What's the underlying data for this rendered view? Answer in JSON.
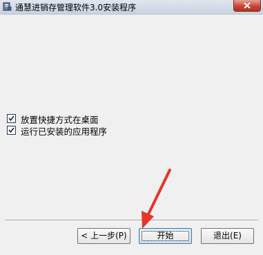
{
  "window": {
    "title": "通慧进销存管理软件3.0安装程序"
  },
  "options": [
    {
      "label": "放置快捷方式在桌面",
      "checked": true
    },
    {
      "label": "运行已安装的应用程序",
      "checked": true
    }
  ],
  "buttons": {
    "back_label": "< 上一步(P)",
    "start_label": "开始",
    "exit_label": "退出(E)"
  },
  "colors": {
    "annotation_arrow": "#e8332a",
    "close_button": "#c6412f"
  }
}
